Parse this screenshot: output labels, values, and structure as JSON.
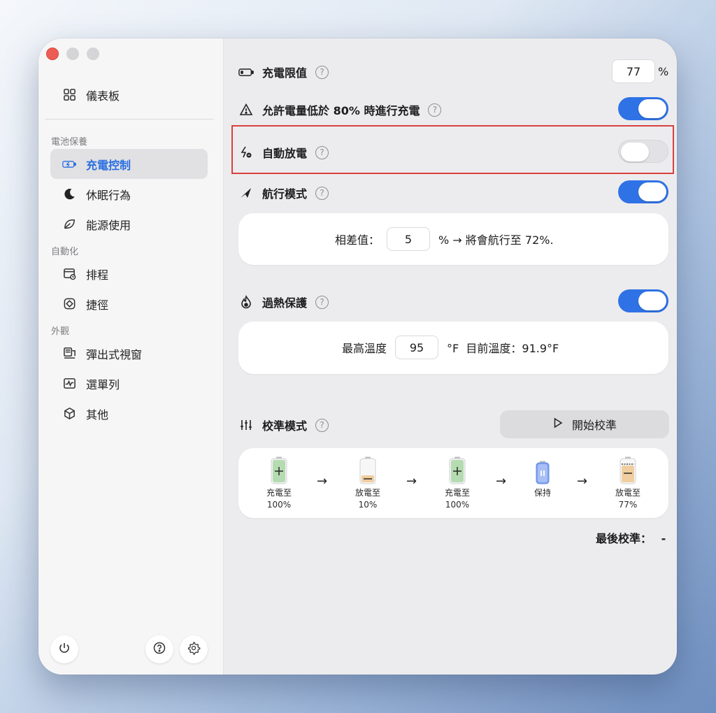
{
  "sidebar": {
    "dashboard": "儀表板",
    "section_battery": "電池保養",
    "charge_control": "充電控制",
    "sleep": "休眠行為",
    "energy": "能源使用",
    "section_automation": "自動化",
    "schedule": "排程",
    "shortcuts": "捷徑",
    "section_appearance": "外觀",
    "popup": "彈出式視窗",
    "menubar": "選單列",
    "other": "其他"
  },
  "main": {
    "charge_limit": {
      "label": "充電限值",
      "value": "77",
      "unit": "%"
    },
    "allow_charge_below": {
      "label": "允許電量低於 80% 時進行充電",
      "enabled": true
    },
    "auto_discharge": {
      "label": "自動放電",
      "enabled": false
    },
    "sailing_mode": {
      "label": "航行模式",
      "enabled": true
    },
    "sailing_card": {
      "diff_label": "相差值：",
      "diff_value": "5",
      "suffix": "% → 將會航行至 72%."
    },
    "heat_protection": {
      "label": "過熱保護",
      "enabled": true
    },
    "heat_card": {
      "max_label": "最高溫度",
      "max_value": "95",
      "suffix": "°F  目前溫度：91.9°F"
    },
    "calibration": {
      "label": "校準模式",
      "start_button": "開始校準",
      "steps": [
        {
          "line1": "充電至",
          "line2": "100%"
        },
        {
          "line1": "放電至",
          "line2": "10%"
        },
        {
          "line1": "充電至",
          "line2": "100%"
        },
        {
          "line1": "保持",
          "line2": ""
        },
        {
          "line1": "放電至",
          "line2": "77%"
        }
      ],
      "arrow": "→",
      "last_label": "最後校準：",
      "last_value": "-"
    },
    "help_glyph": "?"
  },
  "colors": {
    "accent": "#2f72e6",
    "highlight": "#d9403f"
  }
}
